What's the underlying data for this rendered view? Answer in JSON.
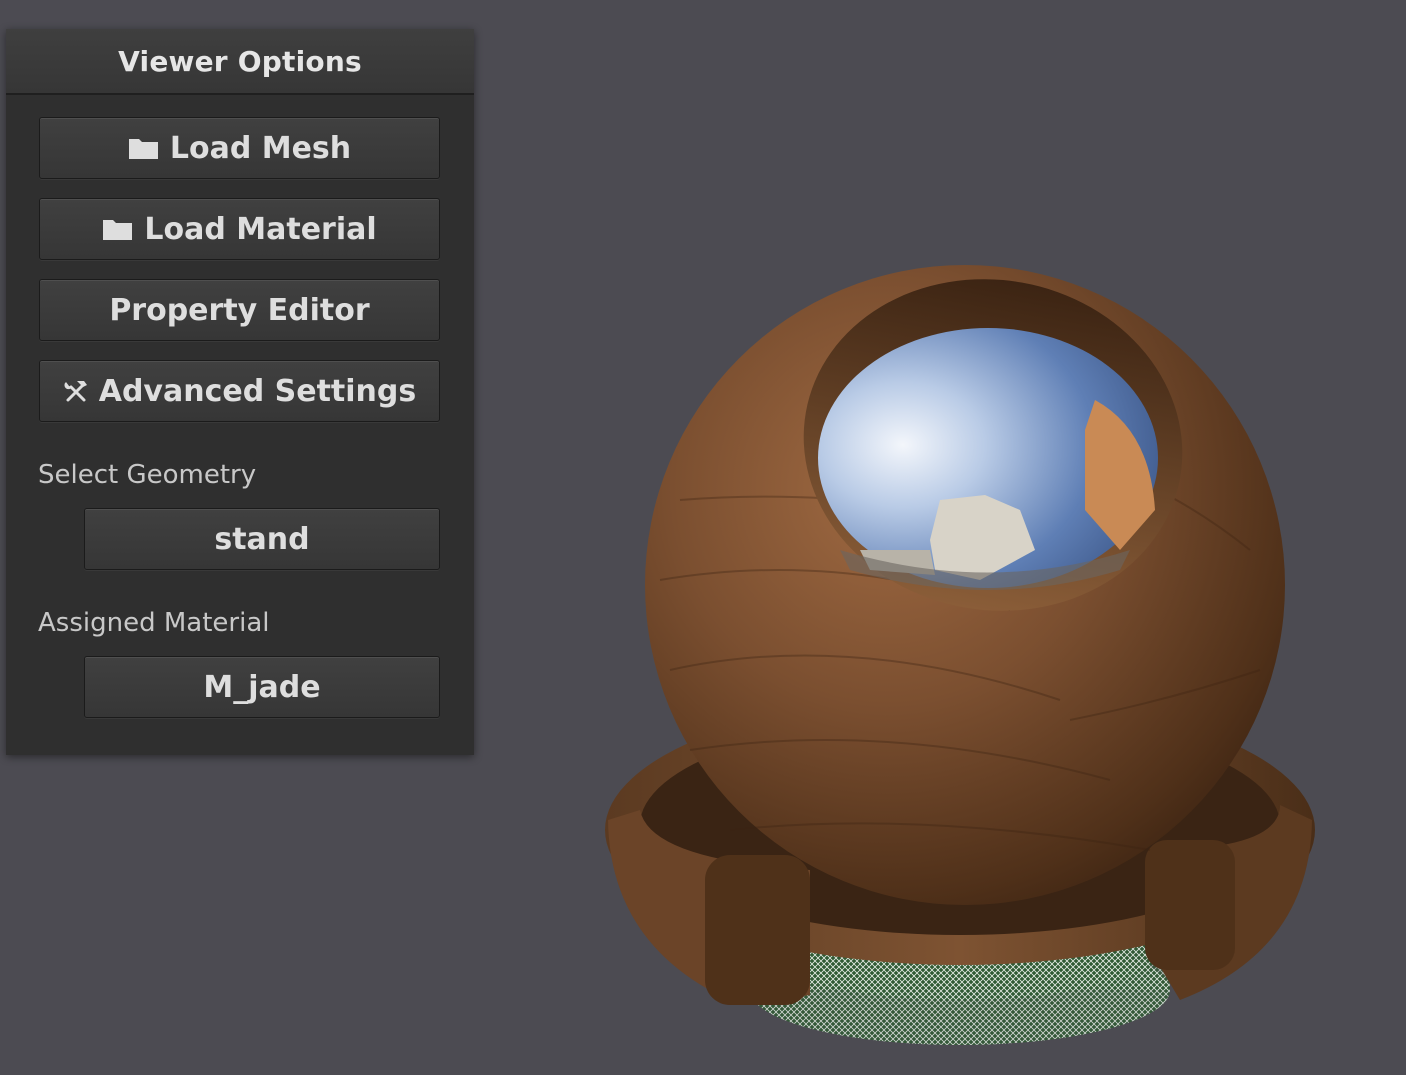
{
  "panel": {
    "title": "Viewer Options",
    "buttons": {
      "load_mesh": "Load Mesh",
      "load_material": "Load Material",
      "property_editor": "Property Editor",
      "advanced_settings": "Advanced Settings"
    },
    "select_geometry": {
      "label": "Select Geometry",
      "value": "stand"
    },
    "assigned_material": {
      "label": "Assigned Material",
      "value": "M_jade"
    }
  },
  "icons": {
    "folder": "folder-icon",
    "tools": "tools-icon"
  },
  "colors": {
    "background": "#4c4b52",
    "panel": "#2f2f2f",
    "wood": "#6b4328",
    "wireframe": "#5e8a5a"
  }
}
